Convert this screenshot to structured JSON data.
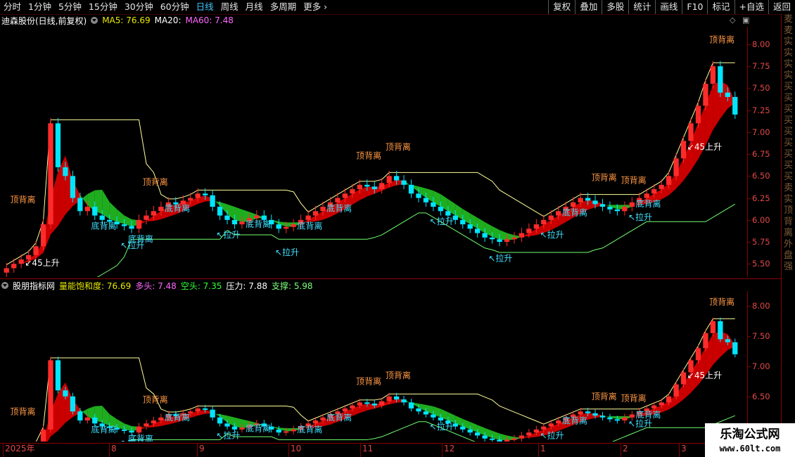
{
  "toolbar": {
    "tabs": [
      "分时",
      "1分钟",
      "5分钟",
      "15分钟",
      "30分钟",
      "60分钟",
      "日线",
      "周线",
      "月线",
      "多周期",
      "更多"
    ],
    "active_tab": "日线",
    "right_buttons": [
      "复权",
      "叠加",
      "多股",
      "统计",
      "画线",
      "F10",
      "标记",
      "+自选",
      "返回"
    ]
  },
  "main_panel": {
    "stock_title": "迪森股份(日线,前复权)",
    "ma5_label": "MA5: 76.69",
    "ma20_label": "MA20:",
    "ma60_label": "MA60: 7.48",
    "y_ticks": [
      "8.00",
      "7.75",
      "7.50",
      "7.25",
      "7.00",
      "6.75",
      "6.50",
      "6.25",
      "6.00",
      "5.75",
      "5.50"
    ],
    "y_min": 5.35,
    "y_max": 8.2
  },
  "sub_panel": {
    "title": "股朋指标网",
    "fields": [
      {
        "label": "量能饱和度: 76.69",
        "color": "#e8e800"
      },
      {
        "label": "多头: 7.48",
        "color": "#ff66ff"
      },
      {
        "label": "空头: 7.35",
        "color": "#33ff33"
      },
      {
        "label": "压力: 7.88",
        "color": "#ffffff"
      },
      {
        "label": "支撑: 5.98",
        "color": "#7cff7c"
      }
    ],
    "y_ticks": [
      "8.00",
      "7.50",
      "7.00",
      "6.50",
      "6.00"
    ],
    "y_min": 5.75,
    "y_max": 8.25
  },
  "x_axis_labels": [
    "2025年",
    "8",
    "9",
    "10",
    "11",
    "12",
    "1",
    "2",
    "3"
  ],
  "annotations": {
    "top": "顶背离",
    "bottom": "底背离",
    "pull": "↖拉升",
    "rise45": "↙45上升"
  },
  "side_chars": [
    "麦",
    "麦",
    "实",
    "实",
    "实",
    "实",
    "买",
    "买",
    "买",
    "买",
    "买",
    "买",
    "买",
    "买",
    "买",
    "卖",
    "实",
    "顶",
    "背",
    "离",
    "外",
    "盘",
    "强"
  ],
  "logo": {
    "line1": "乐淘公式网",
    "line2": "www.60lt.com"
  },
  "colors": {
    "up": "#ff2b2b",
    "down": "#00e5ff",
    "top_label": "#ff9944",
    "bottom_label": "#3fe0ff",
    "pull_label": "#3fe0ff",
    "resistance": "#ffff99",
    "support": "#6fff6f",
    "cloud_bull": "#e00000",
    "cloud_bear": "#22c022"
  },
  "chart_data": {
    "type": "candlestick",
    "closes": [
      5.45,
      5.5,
      5.55,
      5.6,
      5.7,
      5.95,
      7.1,
      6.6,
      6.5,
      6.25,
      6.1,
      6.15,
      6.05,
      6.0,
      5.98,
      5.95,
      5.93,
      5.9,
      6.0,
      6.05,
      6.1,
      6.15,
      6.2,
      6.18,
      6.22,
      6.25,
      6.3,
      6.28,
      6.15,
      6.05,
      6.0,
      5.95,
      5.98,
      6.02,
      6.05,
      6.0,
      5.95,
      5.9,
      5.92,
      5.95,
      6.0,
      6.05,
      6.1,
      6.15,
      6.2,
      6.25,
      6.3,
      6.35,
      6.4,
      6.38,
      6.35,
      6.42,
      6.5,
      6.45,
      6.4,
      6.3,
      6.25,
      6.2,
      6.15,
      6.1,
      6.05,
      6.0,
      5.95,
      5.9,
      5.85,
      5.8,
      5.78,
      5.75,
      5.78,
      5.8,
      5.85,
      5.9,
      5.95,
      6.0,
      6.05,
      6.1,
      6.15,
      6.2,
      6.25,
      6.22,
      6.18,
      6.15,
      6.12,
      6.1,
      6.15,
      6.2,
      6.25,
      6.3,
      6.35,
      6.4,
      6.5,
      6.7,
      6.9,
      7.1,
      7.3,
      7.55,
      7.75,
      7.45,
      7.4,
      7.2
    ]
  }
}
